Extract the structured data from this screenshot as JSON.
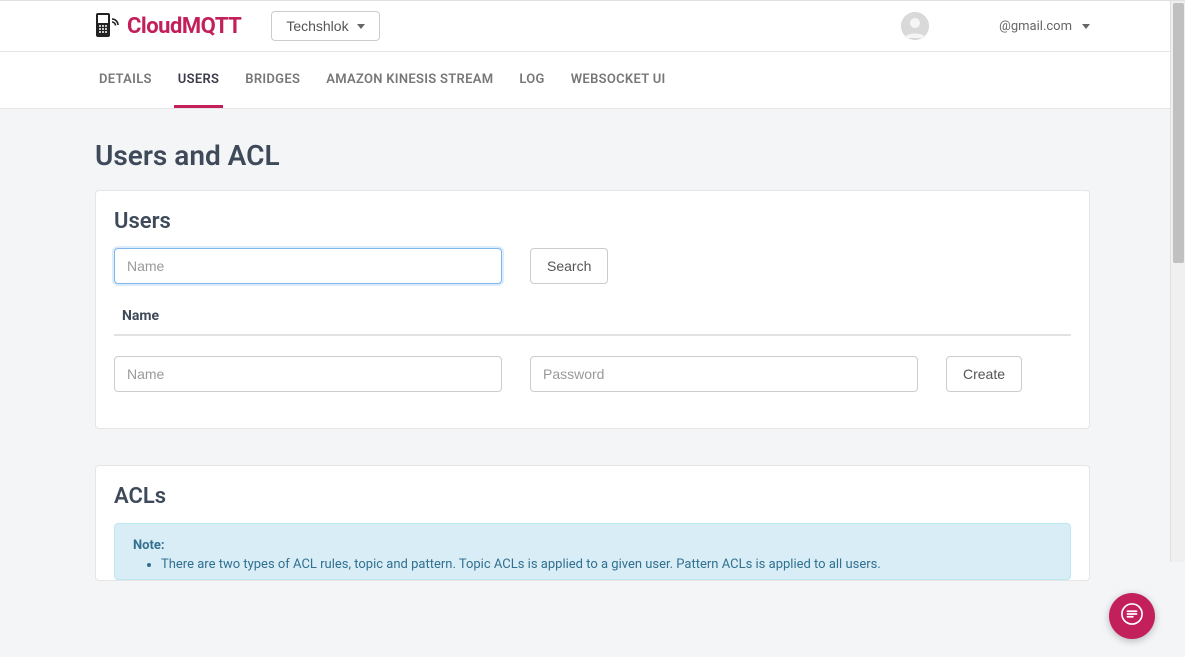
{
  "brand": {
    "name": "CloudMQTT",
    "accent": "#c21f5b"
  },
  "topbar": {
    "instance_label": "Techshlok",
    "user_email": "@gmail.com"
  },
  "tabs": {
    "items": [
      {
        "label": "DETAILS"
      },
      {
        "label": "USERS"
      },
      {
        "label": "BRIDGES"
      },
      {
        "label": "AMAZON KINESIS STREAM"
      },
      {
        "label": "LOG"
      },
      {
        "label": "WEBSOCKET UI"
      }
    ],
    "active_index": 1
  },
  "page": {
    "title": "Users and ACL"
  },
  "users_card": {
    "title": "Users",
    "search": {
      "placeholder": "Name",
      "button_label": "Search",
      "value": ""
    },
    "table": {
      "columns": [
        "Name"
      ],
      "rows": []
    },
    "create_form": {
      "name_placeholder": "Name",
      "password_placeholder": "Password",
      "create_label": "Create"
    }
  },
  "acls_card": {
    "title": "ACLs",
    "note": {
      "heading": "Note:",
      "bullets": [
        "There are two types of ACL rules, topic and pattern. Topic ACLs is applied to a given user. Pattern ACLs is applied to all users."
      ]
    }
  }
}
